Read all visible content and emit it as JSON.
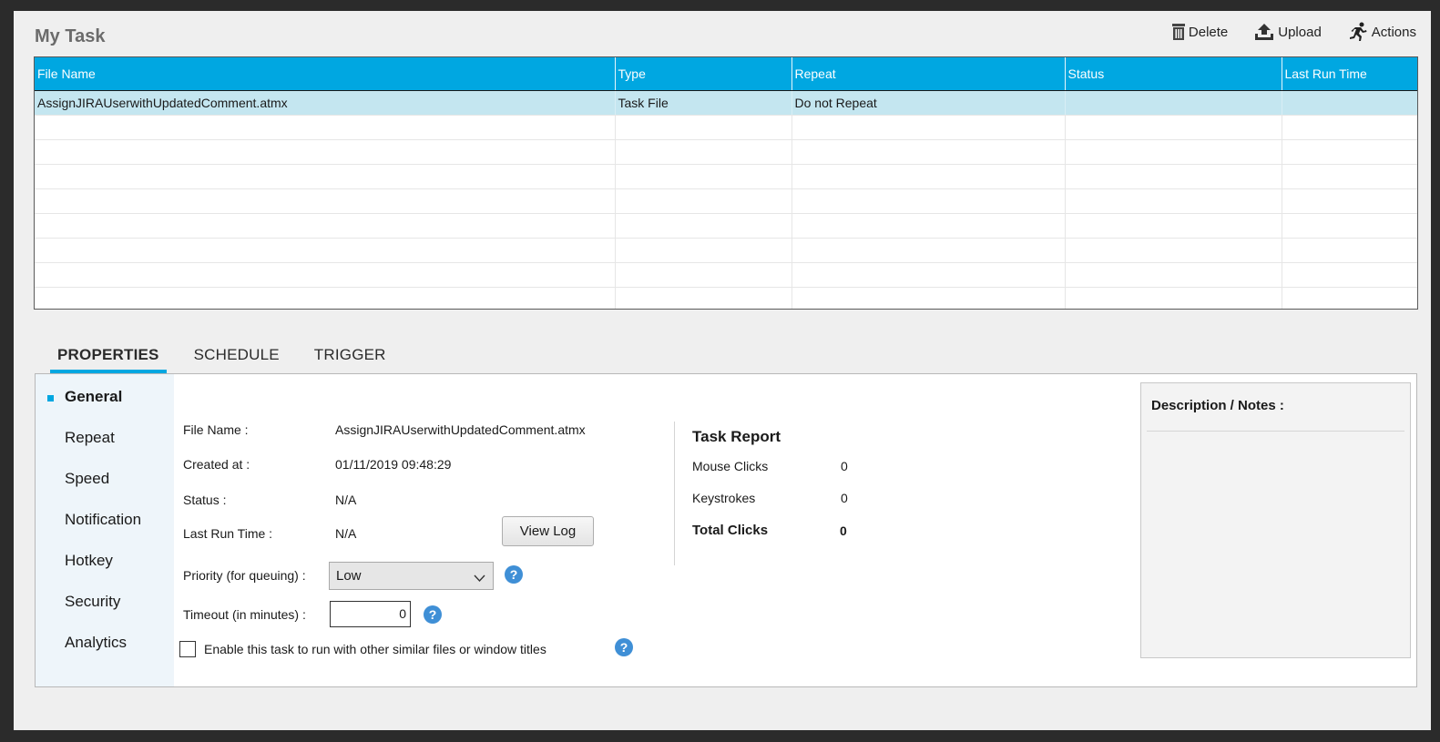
{
  "header": {
    "title": "My Task"
  },
  "toolbar": {
    "delete_label": "Delete",
    "upload_label": "Upload",
    "actions_label": "Actions"
  },
  "grid": {
    "columns": [
      "File Name",
      "Type",
      "Repeat",
      "Status",
      "Last Run Time"
    ],
    "rows": [
      [
        "AssignJIRAUserwithUpdatedComment.atmx",
        "Task File",
        "Do not Repeat",
        "",
        ""
      ]
    ]
  },
  "tabs": [
    "PROPERTIES",
    "SCHEDULE",
    "TRIGGER"
  ],
  "sidebar": {
    "items": [
      "General",
      "Repeat",
      "Speed",
      "Notification",
      "Hotkey",
      "Security",
      "Analytics"
    ]
  },
  "general": {
    "file_name_label": "File Name :",
    "file_name_value": "AssignJIRAUserwithUpdatedComment.atmx",
    "created_label": "Created at :",
    "created_value": "01/11/2019 09:48:29",
    "status_label": "Status :",
    "status_value": "N/A",
    "last_run_label": "Last Run Time :",
    "last_run_value": "N/A",
    "view_log_label": "View Log",
    "priority_label": "Priority (for queuing) :",
    "priority_value": "Low",
    "timeout_label": "Timeout (in minutes) :",
    "timeout_value": "0",
    "enable_label": "Enable this task to run with other similar files or window titles",
    "help_glyph": "?"
  },
  "report": {
    "title": "Task Report",
    "mouse_clicks_label": "Mouse Clicks",
    "mouse_clicks_value": "0",
    "keystrokes_label": "Keystrokes",
    "keystrokes_value": "0",
    "total_clicks_label": "Total Clicks",
    "total_clicks_value": "0"
  },
  "notes": {
    "title": "Description / Notes :"
  },
  "colors": {
    "accent": "#00a7e1",
    "selected_row": "#c4e6f0",
    "help": "#3f8fd6"
  }
}
